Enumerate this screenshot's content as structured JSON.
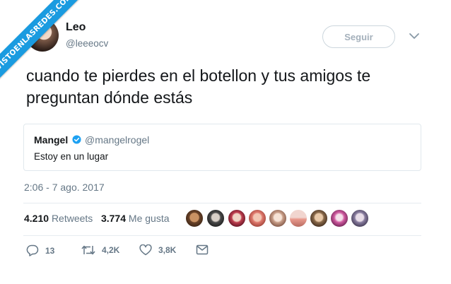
{
  "watermark": {
    "text": "VISTOENLASREDES.COM"
  },
  "author": {
    "name": "Leo",
    "handle": "@leeeocv"
  },
  "follow_button": {
    "label": "Seguir"
  },
  "tweet": {
    "text": "cuando te pierdes en el botellon y tus amigos te preguntan dónde estás"
  },
  "quote": {
    "name": "Mangel",
    "handle": "@mangelrogel",
    "text": "Estoy en un lugar"
  },
  "timestamp": "2:06 - 7 ago. 2017",
  "stats": {
    "retweets_count": "4.210",
    "retweets_label": "Retweets",
    "likes_count": "3.774",
    "likes_label": "Me gusta"
  },
  "actions": {
    "replies": "13",
    "retweets": "4,2K",
    "likes": "3,8K"
  },
  "colors": {
    "accent": "#1da1f2",
    "watermark": "#1a9be0",
    "muted": "#657786",
    "text": "#14171a"
  },
  "icons": [
    "reply-icon",
    "retweet-icon",
    "like-icon",
    "message-icon",
    "verified-icon",
    "chevron-down-icon"
  ]
}
